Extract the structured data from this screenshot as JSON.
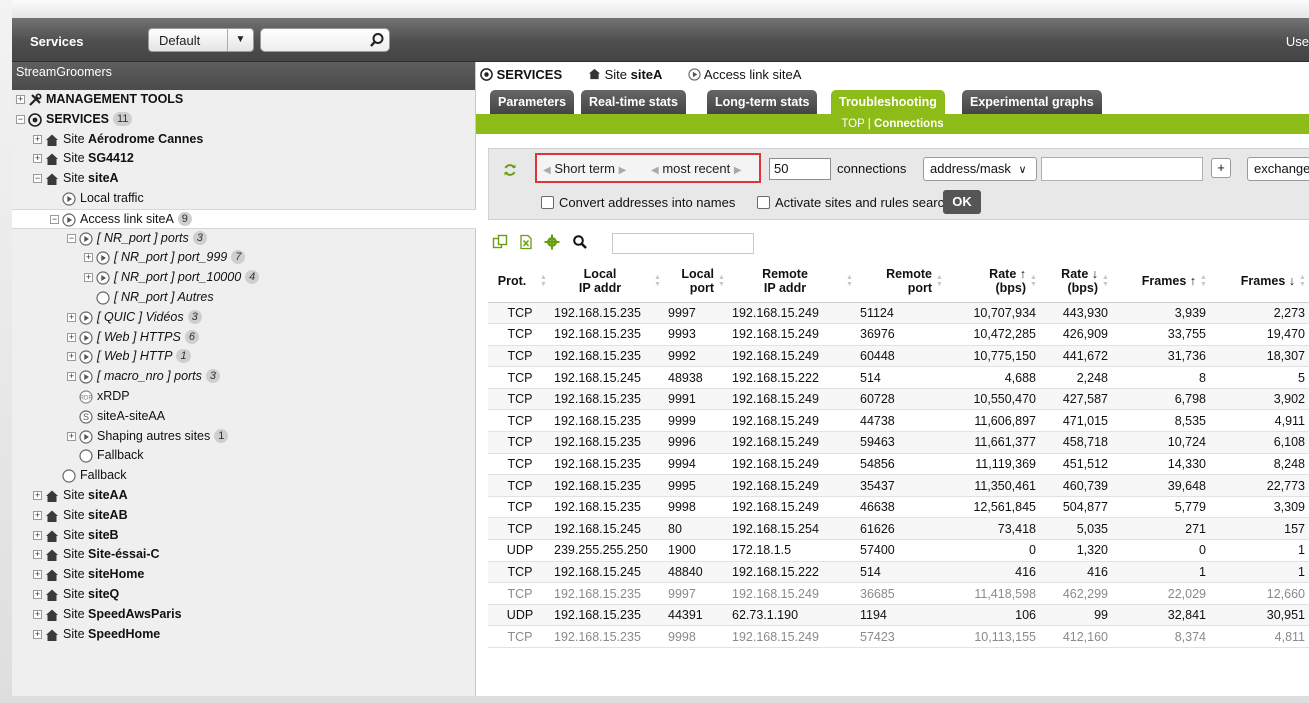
{
  "topbar": {
    "title": "Services",
    "view_select": "Default",
    "search_placeholder": "",
    "user_label": "Use"
  },
  "sidebar": {
    "header": "StreamGroomers",
    "tree": [
      {
        "label": "MANAGEMENT TOOLS",
        "depth": 0,
        "icon": "tools-icon",
        "bold": true,
        "expander": "+"
      },
      {
        "label": "SERVICES",
        "badge": "11",
        "depth": 0,
        "icon": "services-icon",
        "bold": true,
        "expander": "-"
      },
      {
        "prefix": "Site ",
        "label": "Aérodrome Cannes",
        "depth": 1,
        "icon": "home-icon",
        "bold": true,
        "expander": "+"
      },
      {
        "prefix": "Site ",
        "label": "SG4412",
        "depth": 1,
        "icon": "home-icon",
        "bold": true,
        "expander": "+"
      },
      {
        "prefix": "Site ",
        "label": "siteA",
        "depth": 1,
        "icon": "home-icon",
        "bold": true,
        "expander": "-"
      },
      {
        "label": "Local traffic",
        "depth": 2,
        "icon": "play-circle-icon"
      },
      {
        "label": "Access link siteA",
        "badge": "9",
        "depth": 2,
        "icon": "play-circle-icon",
        "expander": "-",
        "selected": true
      },
      {
        "label": "[ NR_port ] ports",
        "badge": "3",
        "depth": 3,
        "icon": "play-circle-icon",
        "expander": "-",
        "italic": true
      },
      {
        "label": "[ NR_port ] port_999",
        "badge": "7",
        "depth": 4,
        "icon": "play-circle-icon",
        "expander": "+",
        "italic": true
      },
      {
        "label": "[ NR_port ] port_10000",
        "badge": "4",
        "depth": 4,
        "icon": "play-circle-icon",
        "expander": "+",
        "italic": true
      },
      {
        "label": "[ NR_port ] Autres",
        "depth": 4,
        "icon": "circle-icon",
        "italic": true
      },
      {
        "label": "[ QUIC ] Vidéos",
        "badge": "3",
        "depth": 3,
        "icon": "play-circle-icon",
        "expander": "+",
        "italic": true
      },
      {
        "label": "[ Web ] HTTPS",
        "badge": "6",
        "depth": 3,
        "icon": "play-circle-icon",
        "expander": "+",
        "italic": true
      },
      {
        "label": "[ Web ] HTTP",
        "badge": "1",
        "depth": 3,
        "icon": "play-circle-icon",
        "expander": "+",
        "italic": true
      },
      {
        "label": "[ macro_nro ] ports",
        "badge": "3",
        "depth": 3,
        "icon": "play-circle-icon",
        "expander": "+",
        "italic": true
      },
      {
        "label": "xRDP",
        "depth": 3,
        "icon": "rdp-icon"
      },
      {
        "label": "siteA-siteAA",
        "depth": 3,
        "icon": "s-circle-icon"
      },
      {
        "label": "Shaping autres sites",
        "badge": "1",
        "depth": 3,
        "icon": "play-circle-icon",
        "expander": "+"
      },
      {
        "label": "Fallback",
        "depth": 3,
        "icon": "circle-icon"
      },
      {
        "label": "Fallback",
        "depth": 2,
        "icon": "circle-icon"
      },
      {
        "prefix": "Site ",
        "label": "siteAA",
        "depth": 1,
        "icon": "home-icon",
        "bold": true,
        "expander": "+"
      },
      {
        "prefix": "Site ",
        "label": "siteAB",
        "depth": 1,
        "icon": "home-icon",
        "bold": true,
        "expander": "+"
      },
      {
        "prefix": "Site ",
        "label": "siteB",
        "depth": 1,
        "icon": "home-icon",
        "bold": true,
        "expander": "+"
      },
      {
        "prefix": "Site ",
        "label": "Site-éssai-C",
        "depth": 1,
        "icon": "home-icon",
        "bold": true,
        "expander": "+"
      },
      {
        "prefix": "Site ",
        "label": "siteHome",
        "depth": 1,
        "icon": "home-icon",
        "bold": true,
        "expander": "+"
      },
      {
        "prefix": "Site ",
        "label": "siteQ",
        "depth": 1,
        "icon": "home-icon",
        "bold": true,
        "expander": "+"
      },
      {
        "prefix": "Site ",
        "label": "SpeedAwsParis",
        "depth": 1,
        "icon": "home-icon",
        "bold": true,
        "expander": "+"
      },
      {
        "prefix": "Site ",
        "label": "SpeedHome",
        "depth": 1,
        "icon": "home-icon",
        "bold": true,
        "expander": "+"
      }
    ]
  },
  "breadcrumb": {
    "services": "SERVICES",
    "site_prefix": "Site ",
    "site": "siteA",
    "link": "Access link siteA"
  },
  "tabs": [
    {
      "label": "Parameters"
    },
    {
      "label": "Real-time stats"
    },
    {
      "label": "Long-term stats"
    },
    {
      "label": "Troubleshooting",
      "active": true
    },
    {
      "label": "Experimental graphs"
    }
  ],
  "subnav": {
    "top": "TOP",
    "sep": " | ",
    "connections": "Connections"
  },
  "filters": {
    "period_term": "Short term",
    "period_recency": "most recent",
    "count_value": "50",
    "count_label": "connections",
    "address_select": "address/mask",
    "address_value": "",
    "plus_label": "+",
    "exchange_select": "exchange",
    "convert_label": "Convert addresses into names",
    "activate_label": "Activate sites and rules search",
    "ok_label": "OK"
  },
  "table": {
    "columns": [
      {
        "l1": "Prot.",
        "l2": ""
      },
      {
        "l1": "Local",
        "l2": "IP addr"
      },
      {
        "l1": "Local",
        "l2": "port"
      },
      {
        "l1": "Remote",
        "l2": "IP addr"
      },
      {
        "l1": "Remote",
        "l2": "port"
      },
      {
        "l1": "Rate ↑",
        "l2": "(bps)"
      },
      {
        "l1": "Rate ↓",
        "l2": "(bps)"
      },
      {
        "l1": "Frames ↑",
        "l2": ""
      },
      {
        "l1": "Frames ↓",
        "l2": ""
      }
    ],
    "rows": [
      {
        "cells": [
          "TCP",
          "192.168.15.235",
          "9997",
          "192.168.15.249",
          "51124",
          "10,707,934",
          "443,930",
          "3,939",
          "2,273"
        ]
      },
      {
        "cells": [
          "TCP",
          "192.168.15.235",
          "9993",
          "192.168.15.249",
          "36976",
          "10,472,285",
          "426,909",
          "33,755",
          "19,470"
        ]
      },
      {
        "cells": [
          "TCP",
          "192.168.15.235",
          "9992",
          "192.168.15.249",
          "60448",
          "10,775,150",
          "441,672",
          "31,736",
          "18,307"
        ]
      },
      {
        "cells": [
          "TCP",
          "192.168.15.245",
          "48938",
          "192.168.15.222",
          "514",
          "4,688",
          "2,248",
          "8",
          "5"
        ]
      },
      {
        "cells": [
          "TCP",
          "192.168.15.235",
          "9991",
          "192.168.15.249",
          "60728",
          "10,550,470",
          "427,587",
          "6,798",
          "3,902"
        ]
      },
      {
        "cells": [
          "TCP",
          "192.168.15.235",
          "9999",
          "192.168.15.249",
          "44738",
          "11,606,897",
          "471,015",
          "8,535",
          "4,911"
        ]
      },
      {
        "cells": [
          "TCP",
          "192.168.15.235",
          "9996",
          "192.168.15.249",
          "59463",
          "11,661,377",
          "458,718",
          "10,724",
          "6,108"
        ]
      },
      {
        "cells": [
          "TCP",
          "192.168.15.235",
          "9994",
          "192.168.15.249",
          "54856",
          "11,119,369",
          "451,512",
          "14,330",
          "8,248"
        ]
      },
      {
        "cells": [
          "TCP",
          "192.168.15.235",
          "9995",
          "192.168.15.249",
          "35437",
          "11,350,461",
          "460,739",
          "39,648",
          "22,773"
        ]
      },
      {
        "cells": [
          "TCP",
          "192.168.15.235",
          "9998",
          "192.168.15.249",
          "46638",
          "12,561,845",
          "504,877",
          "5,779",
          "3,309"
        ]
      },
      {
        "cells": [
          "TCP",
          "192.168.15.245",
          "80",
          "192.168.15.254",
          "61626",
          "73,418",
          "5,035",
          "271",
          "157"
        ]
      },
      {
        "cells": [
          "UDP",
          "239.255.255.250",
          "1900",
          "172.18.1.5",
          "57400",
          "0",
          "1,320",
          "0",
          "1"
        ]
      },
      {
        "cells": [
          "TCP",
          "192.168.15.245",
          "48840",
          "192.168.15.222",
          "514",
          "416",
          "416",
          "1",
          "1"
        ]
      },
      {
        "cells": [
          "TCP",
          "192.168.15.235",
          "9997",
          "192.168.15.249",
          "36685",
          "11,418,598",
          "462,299",
          "22,029",
          "12,660"
        ],
        "dim": true
      },
      {
        "cells": [
          "UDP",
          "192.168.15.235",
          "44391",
          "62.73.1.190",
          "1194",
          "106",
          "99",
          "32,841",
          "30,951"
        ]
      },
      {
        "cells": [
          "TCP",
          "192.168.15.235",
          "9998",
          "192.168.15.249",
          "57423",
          "10,113,155",
          "412,160",
          "8,374",
          "4,811"
        ],
        "dim": true
      }
    ]
  },
  "colors": {
    "accent_green": "#8dbb17",
    "period_border": "#d9363a",
    "dark_bar": "#4e4e4e"
  }
}
